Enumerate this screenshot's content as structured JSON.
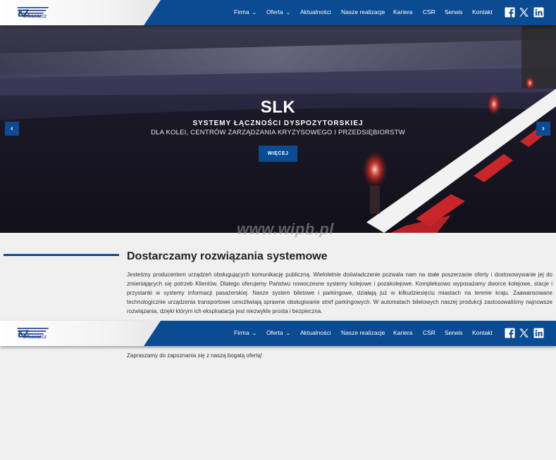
{
  "logo": {
    "brand": "KZ",
    "city": "BYDGOSZCZ"
  },
  "nav": [
    {
      "label": "Firma",
      "dropdown": true
    },
    {
      "label": "Oferta",
      "dropdown": true
    },
    {
      "label": "Aktualności",
      "dropdown": false
    },
    {
      "label": "Nasze realizacje",
      "dropdown": false
    },
    {
      "label": "Kariera",
      "dropdown": false
    },
    {
      "label": "CSR",
      "dropdown": false
    },
    {
      "label": "Serwis",
      "dropdown": false
    },
    {
      "label": "Kontakt",
      "dropdown": false
    }
  ],
  "social": [
    "facebook-icon",
    "x-twitter-icon",
    "linkedin-icon"
  ],
  "hero": {
    "title": "SLK",
    "subtitle": "SYSTEMY ŁĄCZNOŚCI DYSPOZYTORSKIEJ",
    "subtitle2": "DLA KOLEI, CENTRÓW ZARZĄDZANIA KRYZYSOWEGO I PRZEDSIĘBIORSTW",
    "button": "WIĘCEJ",
    "prev": "‹",
    "next": "›"
  },
  "watermark": "www.wipb.pl",
  "content": {
    "heading": "Dostarczamy rozwiązania systemowe",
    "paragraph": "Jesteśmy producentem urządzeń obsługujących komunikację publiczną. Wieloletnie doświadczenie pozwala nam na stałe poszerzanie oferty i dostosowywanie jej do zmieniających się potrzeb Klientów. Dlatego oferujemy Państwu nowoczesne systemy kolejowe i pozakolejowe. Kompleksowo wyposażamy dworce kolejowe, stacje i przystanki w systemy informacji pasażerskiej. Nasze system biletowe i parkingowe, działają już w kilkudziesięciu miastach na terenie kraju. Zaawansowane technologicznie urządzenia transportowe umożliwiają sprawne obsługiwanie stref parkingowych. W automatach biletowych naszej produkcji zastosowaliśmy najnowsze rozwiązania, dzięki którym ich eksploatacja jest niezwykle prosta i bezpieczna.",
    "paragraph2": "Zapraszamy do zapoznania się z naszą bogatą ofertą!"
  },
  "colors": {
    "brand_blue": "#0b4b92",
    "text": "#333333",
    "background": "#f0f0f0"
  }
}
